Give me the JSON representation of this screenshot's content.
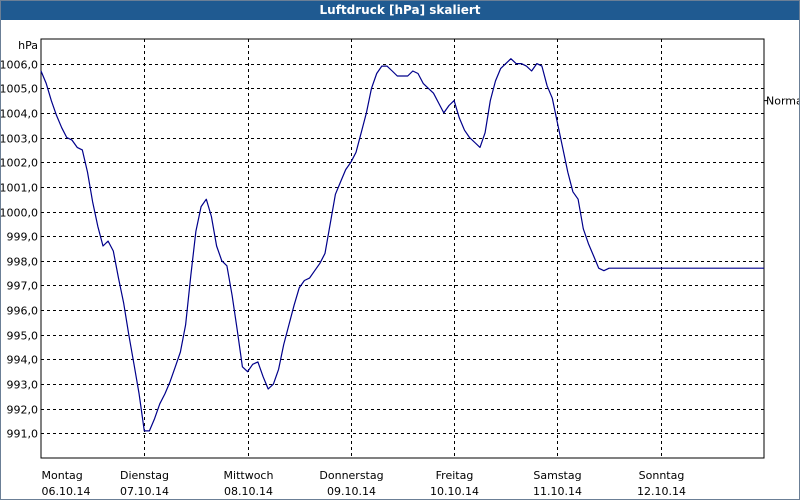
{
  "window": {
    "title": "Luftdruck [hPa] skaliert"
  },
  "chart_data": {
    "type": "line",
    "title": "Luftdruck [hPa] skaliert",
    "ylabel": "hPa",
    "ylim": [
      990.0,
      1007.0
    ],
    "yticks": [
      "991,0",
      "992,0",
      "993,0",
      "994,0",
      "995,0",
      "996,0",
      "997,0",
      "998,0",
      "999,0",
      "1000,0",
      "1001,0",
      "1002,0",
      "1003,0",
      "1004,0",
      "1005,0",
      "1006,0"
    ],
    "ytick_values": [
      991,
      992,
      993,
      994,
      995,
      996,
      997,
      998,
      999,
      1000,
      1001,
      1002,
      1003,
      1004,
      1005,
      1006
    ],
    "xlim": [
      0,
      7
    ],
    "xticks": [
      {
        "day": "Montag",
        "date": "06.10.14"
      },
      {
        "day": "Dienstag",
        "date": "07.10.14"
      },
      {
        "day": "Mittwoch",
        "date": "08.10.14"
      },
      {
        "day": "Donnerstag",
        "date": "09.10.14"
      },
      {
        "day": "Freitag",
        "date": "10.10.14"
      },
      {
        "day": "Samstag",
        "date": "11.10.14"
      },
      {
        "day": "Sonntag",
        "date": "12.10.14"
      }
    ],
    "grid": true,
    "reference_line": {
      "label": "Normal",
      "value": 1004.5
    },
    "line_color": "#00008b",
    "series": [
      {
        "x": [
          0.0,
          0.05,
          0.1,
          0.15,
          0.2,
          0.25,
          0.3,
          0.35,
          0.4,
          0.45,
          0.5,
          0.55,
          0.6,
          0.65,
          0.7,
          0.75,
          0.8,
          0.85,
          0.9,
          0.95,
          1.0,
          1.05,
          1.1,
          1.15,
          1.2,
          1.25,
          1.3,
          1.35,
          1.4,
          1.45,
          1.5,
          1.55,
          1.6,
          1.65,
          1.7,
          1.75,
          1.8,
          1.85,
          1.9,
          1.95,
          2.0,
          2.05,
          2.1,
          2.15,
          2.2,
          2.25,
          2.3,
          2.35,
          2.4,
          2.45,
          2.5,
          2.55,
          2.6,
          2.65,
          2.7,
          2.75,
          2.8,
          2.85,
          2.9,
          2.95,
          3.0,
          3.05,
          3.1,
          3.15,
          3.2,
          3.25,
          3.3,
          3.35,
          3.4,
          3.45,
          3.5,
          3.55,
          3.6,
          3.65,
          3.7,
          3.75,
          3.8,
          3.85,
          3.9,
          3.95,
          4.0,
          4.05,
          4.1,
          4.15,
          4.2,
          4.25,
          4.3,
          4.35,
          4.4,
          4.45,
          4.5,
          4.55,
          4.6,
          4.65,
          4.7,
          4.75,
          4.8,
          4.85,
          4.9,
          4.95,
          5.0,
          5.05,
          5.1,
          5.15,
          5.2,
          5.25,
          5.3,
          5.35,
          5.4,
          5.45,
          5.5,
          5.55,
          5.6,
          5.65,
          5.7,
          5.75,
          5.8,
          5.85,
          5.9,
          5.95,
          6.0,
          6.05,
          6.1,
          6.15,
          6.2,
          6.25,
          6.3,
          6.35,
          6.4,
          6.45,
          6.5,
          6.55,
          6.6,
          6.65,
          6.7,
          6.75,
          6.8,
          6.85,
          6.9,
          6.95,
          7.0
        ],
        "y": [
          1005.7,
          1005.2,
          1004.5,
          1003.9,
          1003.4,
          1003.0,
          1002.9,
          1002.6,
          1002.5,
          1001.6,
          1000.4,
          999.4,
          998.6,
          998.8,
          998.4,
          997.3,
          996.3,
          995.0,
          993.8,
          992.6,
          991.1,
          991.1,
          991.6,
          992.2,
          992.6,
          993.1,
          993.7,
          994.3,
          995.4,
          997.4,
          999.2,
          1000.2,
          1000.5,
          999.8,
          998.6,
          998.0,
          997.8,
          996.6,
          995.2,
          993.7,
          993.5,
          993.8,
          993.9,
          993.3,
          992.8,
          993.0,
          993.6,
          994.6,
          995.4,
          996.2,
          996.9,
          997.2,
          997.3,
          997.6,
          997.9,
          998.3,
          999.5,
          1000.7,
          1001.2,
          1001.7,
          1002.0,
          1002.4,
          1003.2,
          1004.0,
          1005.0,
          1005.6,
          1005.9,
          1005.9,
          1005.7,
          1005.5,
          1005.5,
          1005.5,
          1005.7,
          1005.6,
          1005.2,
          1005.0,
          1004.8,
          1004.4,
          1004.0,
          1004.3,
          1004.5,
          1003.8,
          1003.3,
          1003.0,
          1002.8,
          1002.6,
          1003.2,
          1004.5,
          1005.3,
          1005.8,
          1006.0,
          1006.2,
          1006.0,
          1006.0,
          1005.9,
          1005.7,
          1006.0,
          1005.9,
          1005.1,
          1004.6,
          1003.6,
          1002.6,
          1001.6,
          1000.8,
          1000.5,
          999.3,
          998.7,
          998.2,
          997.7,
          997.6,
          997.7,
          997.7,
          997.7,
          997.7,
          997.7,
          997.7,
          997.7,
          997.7,
          997.7,
          997.7,
          997.7,
          997.7,
          997.7,
          997.7,
          997.7,
          997.7,
          997.7,
          997.7,
          997.7,
          997.7,
          997.7,
          997.7,
          997.7,
          997.7,
          997.7,
          997.7,
          997.7,
          997.7,
          997.7,
          997.7,
          997.7
        ]
      }
    ]
  }
}
